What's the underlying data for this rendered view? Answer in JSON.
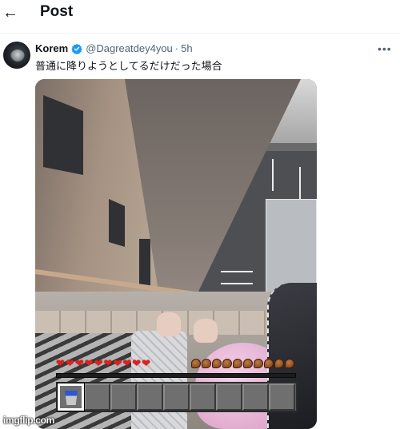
{
  "header": {
    "back_icon": "arrow-left-icon",
    "title": "Post"
  },
  "tweet": {
    "author_name": "Korem",
    "verified_icon": "verified-badge-icon",
    "handle": "@Dagreatdey4you",
    "separator": "·",
    "time": "5h",
    "more_icon": "more-dots-icon",
    "text": "普通に降りようとしてるだけだった場合"
  },
  "media": {
    "hud": {
      "hearts": 10,
      "food": 10,
      "hotbar_slots": 9,
      "selected_slot": 1,
      "selected_item_icon": "water-bucket-icon"
    }
  },
  "watermark": "imgflip.com",
  "colors": {
    "text_primary": "#0f1419",
    "text_secondary": "#536471",
    "verified_blue": "#1d9bf0",
    "heart_red": "#e0201c"
  }
}
